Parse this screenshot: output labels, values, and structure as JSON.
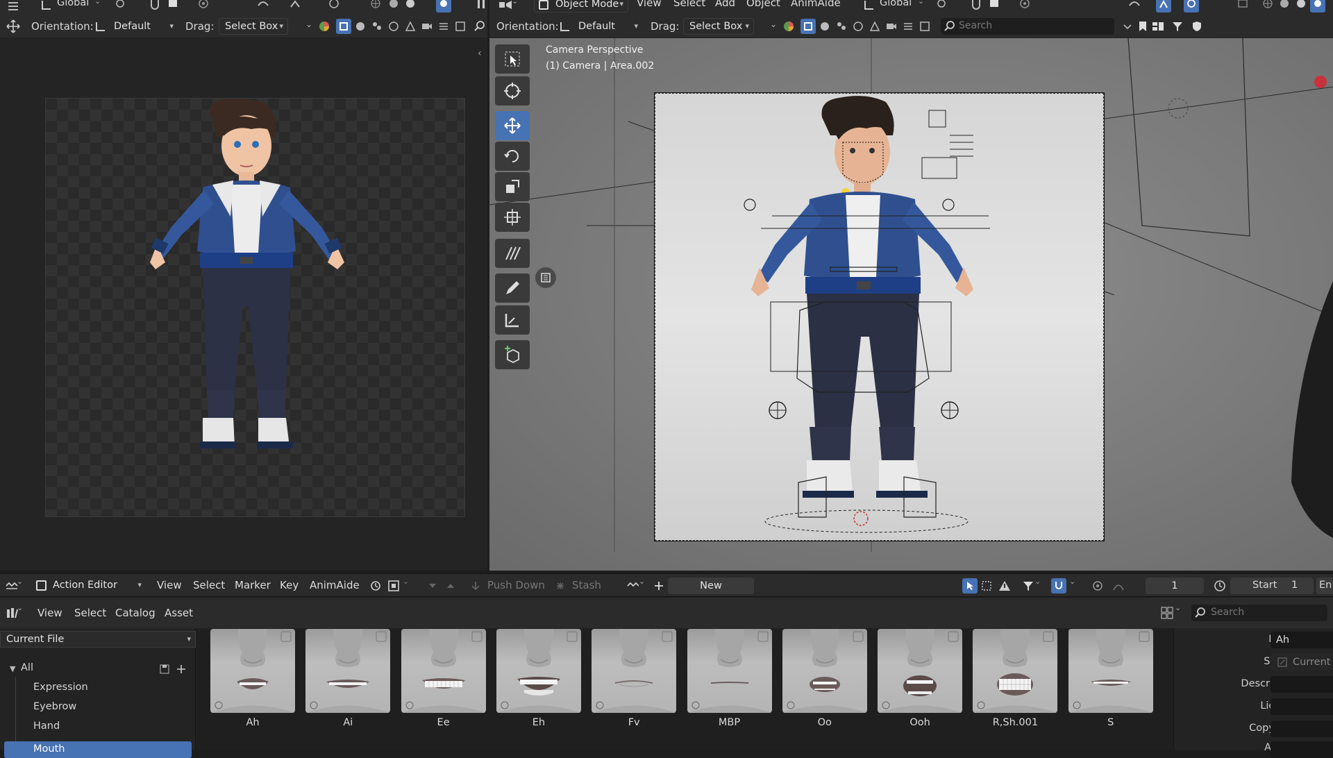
{
  "left_header": {
    "row1": {
      "transform_label": "Global"
    },
    "row2": {
      "orientation_label": "Orientation:",
      "orientation_value": "Default",
      "drag_label": "Drag:",
      "drag_value": "Select Box"
    }
  },
  "right_header": {
    "row1": {
      "mode": "Object Mode",
      "menus": [
        "View",
        "Select",
        "Add",
        "Object",
        "AnimAide"
      ],
      "transform_label": "Global"
    },
    "row2": {
      "orientation_label": "Orientation:",
      "orientation_value": "Default",
      "drag_label": "Drag:",
      "drag_value": "Select Box",
      "search_placeholder": "Search"
    }
  },
  "viewport": {
    "overlay_line1": "Camera Perspective",
    "overlay_line2": "(1) Camera | Area.002"
  },
  "action_bar": {
    "editor": "Action Editor",
    "menus": [
      "View",
      "Select",
      "Marker",
      "Key",
      "AnimAide"
    ],
    "push_down": "Push Down",
    "stash": "Stash",
    "new_label": "New",
    "frame_current": "1",
    "start_label": "Start",
    "start_value": "1",
    "end_label": "En"
  },
  "asset_bar": {
    "menus": [
      "View",
      "Select",
      "Catalog",
      "Asset"
    ],
    "search_placeholder": "Search"
  },
  "asset_browser": {
    "library": "Current File",
    "tree": {
      "root": "All",
      "items": [
        "Expression",
        "Eyebrow",
        "Hand",
        "Mouth"
      ],
      "selected": "Mouth"
    },
    "assets": [
      {
        "name": "Ah",
        "mouth": "open-teeth"
      },
      {
        "name": "Ai",
        "mouth": "wide-smile"
      },
      {
        "name": "Ee",
        "mouth": "teeth-grin"
      },
      {
        "name": "Eh",
        "mouth": "teeth-open"
      },
      {
        "name": "Fv",
        "mouth": "lip-bite"
      },
      {
        "name": "MBP",
        "mouth": "closed"
      },
      {
        "name": "Oo",
        "mouth": "round"
      },
      {
        "name": "Ooh",
        "mouth": "round-open"
      },
      {
        "name": "R,Sh.001",
        "mouth": "teeth-round"
      },
      {
        "name": "S",
        "mouth": "flat-teeth"
      }
    ]
  },
  "properties": {
    "name_label": "Name",
    "name_value": "Ah",
    "source_label": "Source",
    "source_value": "Current F",
    "description_label": "Description",
    "license_label": "License",
    "copyright_label": "Copyright",
    "author_label": "Author"
  },
  "colors": {
    "accent": "#4772b3",
    "record": "#c8323c",
    "panel": "#2b2b2b"
  }
}
